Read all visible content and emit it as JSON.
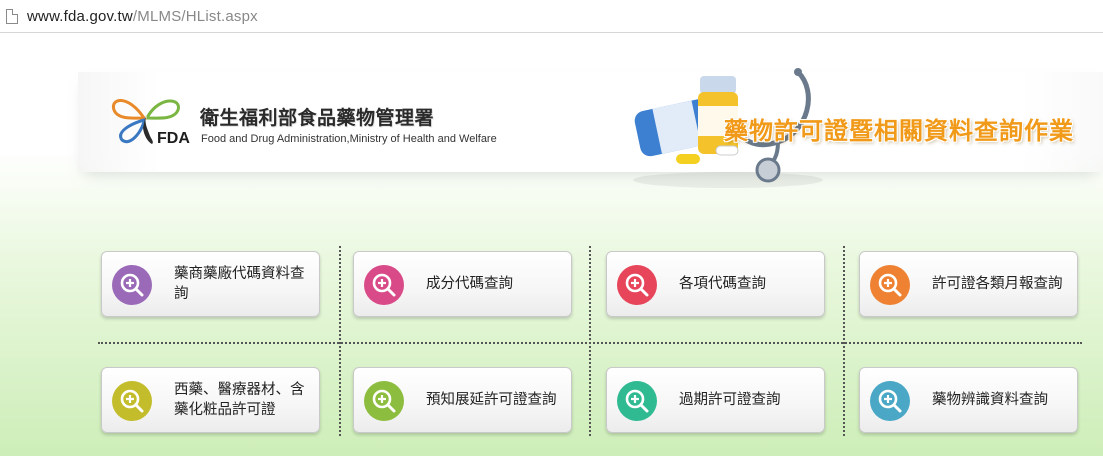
{
  "browser": {
    "url_domain": "www.fda.gov.tw",
    "url_path": "/MLMS/HList.aspx"
  },
  "header": {
    "org_name_cn": "衛生福利部食品藥物管理署",
    "org_name_en": "Food and Drug Administration,Ministry of Health and Welfare",
    "logo_text": "FDA",
    "system_title": "藥物許可證暨相關資料查詢作業"
  },
  "menu": [
    {
      "label": "藥商藥廠代碼資料查詢",
      "icon": "search-icon",
      "color": "#9a6ab8"
    },
    {
      "label": "成分代碼查詢",
      "icon": "search-icon",
      "color": "#d94b88"
    },
    {
      "label": "各項代碼查詢",
      "icon": "search-icon",
      "color": "#e6455a"
    },
    {
      "label": "許可證各類月報查詢",
      "icon": "search-icon",
      "color": "#ee8232"
    },
    {
      "label": "西藥、醫療器材、含藥化粧品許可證",
      "icon": "search-icon",
      "color": "#c3bd2c"
    },
    {
      "label": "預知展延許可證查詢",
      "icon": "search-icon",
      "color": "#8cbd3e"
    },
    {
      "label": "過期許可證查詢",
      "icon": "search-icon",
      "color": "#2fba92"
    },
    {
      "label": "藥物辨識資料查詢",
      "icon": "search-icon",
      "color": "#4aa8c6"
    }
  ]
}
